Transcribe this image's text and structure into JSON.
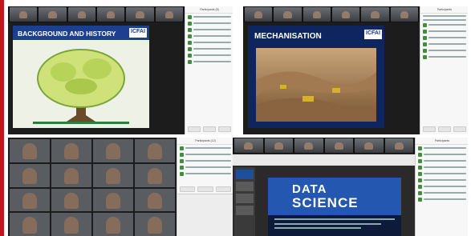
{
  "screens": {
    "top_left": {
      "slide_title": "BACKGROUND AND HISTORY",
      "logo": "ICFAI",
      "panel_title": "Participants (8)"
    },
    "top_right": {
      "slide_title": "MECHANISATION",
      "logo": "ICFAI",
      "panel_title": "Participants"
    },
    "bottom_left": {
      "panel_title": "Participants (12)"
    },
    "bottom_right": {
      "slide_word_1": "DATA",
      "slide_word_2": "SCIENCE",
      "panel_title": "Participants"
    }
  },
  "colors": {
    "accent_red": "#c4161c",
    "slide_blue": "#1d3f8f",
    "participant_green": "#3f8f3f"
  }
}
